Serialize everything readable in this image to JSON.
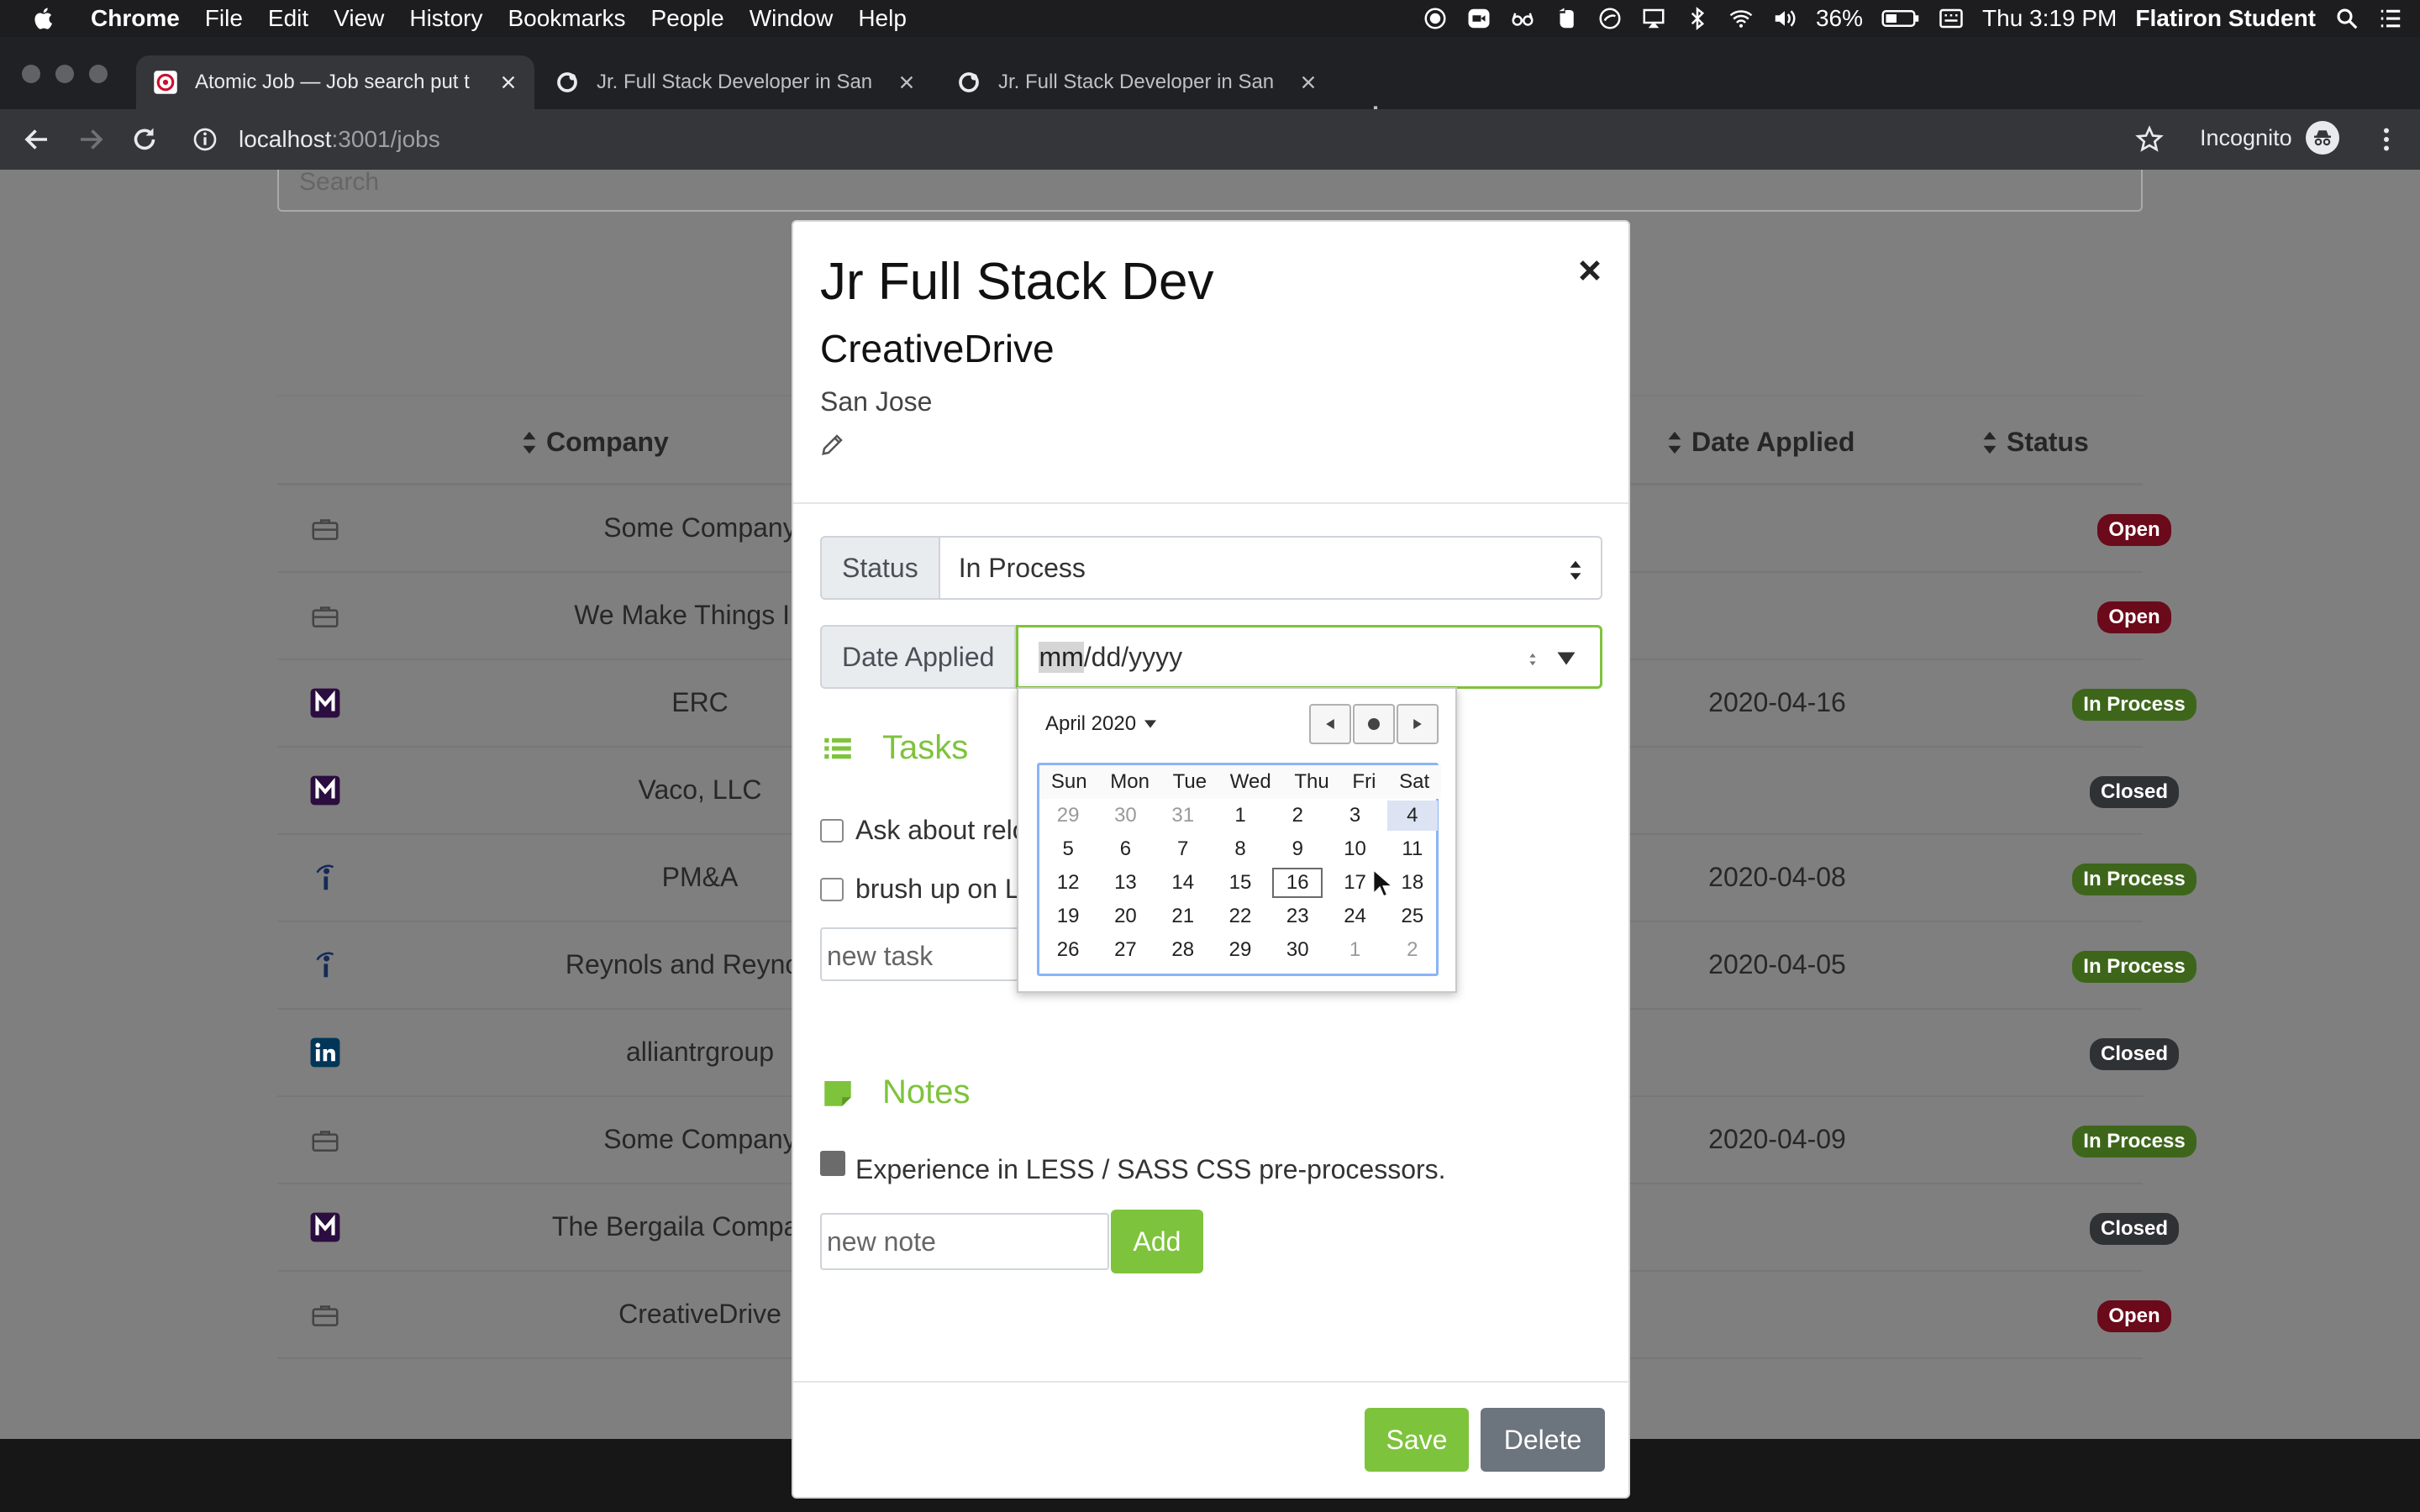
{
  "menubar": {
    "app": "Chrome",
    "items": [
      "File",
      "Edit",
      "View",
      "History",
      "Bookmarks",
      "People",
      "Window",
      "Help"
    ],
    "battery": "36%",
    "clock": "Thu 3:19 PM",
    "user": "Flatiron Student"
  },
  "tabs": [
    {
      "title": "Atomic Job — Job search put t",
      "active": true
    },
    {
      "title": "Jr. Full Stack Developer in San"
    },
    {
      "title": "Jr. Full Stack Developer in San"
    }
  ],
  "address": {
    "host": "localhost",
    "path": ":3001/jobs"
  },
  "incognito": "Incognito",
  "search": {
    "placeholder": "Search"
  },
  "table": {
    "headers": {
      "company": "Company",
      "date": "Date Applied",
      "status": "Status"
    },
    "rows": [
      {
        "company": "Some Company",
        "date": "",
        "status": "Open",
        "icon": "briefcase"
      },
      {
        "company": "We Make Things Inc.",
        "date": "",
        "status": "Open",
        "icon": "briefcase"
      },
      {
        "company": "ERC",
        "date": "2020-04-16",
        "status": "In Process",
        "icon": "monster"
      },
      {
        "company": "Vaco, LLC",
        "date": "",
        "status": "Closed",
        "icon": "monster"
      },
      {
        "company": "PM&A",
        "date": "2020-04-08",
        "status": "In Process",
        "icon": "indeed"
      },
      {
        "company": "Reynols and Reynolds",
        "date": "2020-04-05",
        "status": "In Process",
        "icon": "indeed"
      },
      {
        "company": "alliantrgroup",
        "date": "",
        "status": "Closed",
        "icon": "linkedin"
      },
      {
        "company": "Some Company",
        "date": "2020-04-09",
        "status": "In Process",
        "icon": "briefcase"
      },
      {
        "company": "The Bergaila Companies",
        "date": "",
        "status": "Closed",
        "icon": "monster"
      },
      {
        "company": "CreativeDrive",
        "date": "",
        "status": "Open",
        "icon": "briefcase"
      }
    ]
  },
  "modal": {
    "title": "Jr Full Stack Dev",
    "company": "CreativeDrive",
    "location": "San Jose",
    "status_label": "Status",
    "status_value": "In Process",
    "date_label": "Date Applied",
    "date_mm": "mm",
    "date_rest": "/dd/yyyy",
    "tasks_title": "Tasks",
    "tasks": [
      "Ask about relo",
      "brush up on L"
    ],
    "new_task_placeholder": "new task",
    "notes_title": "Notes",
    "notes": [
      "Experience in LESS / SASS CSS pre-processors."
    ],
    "new_note_placeholder": "new note",
    "add": "Add",
    "save": "Save",
    "delete": "Delete"
  },
  "calendar": {
    "month": "April 2020",
    "dow": [
      "Sun",
      "Mon",
      "Tue",
      "Wed",
      "Thu",
      "Fri",
      "Sat"
    ],
    "weeks": [
      [
        "29",
        "30",
        "31",
        "1",
        "2",
        "3",
        "4"
      ],
      [
        "5",
        "6",
        "7",
        "8",
        "9",
        "10",
        "11"
      ],
      [
        "12",
        "13",
        "14",
        "15",
        "16",
        "17",
        "18"
      ],
      [
        "19",
        "20",
        "21",
        "22",
        "23",
        "24",
        "25"
      ],
      [
        "26",
        "27",
        "28",
        "29",
        "30",
        "1",
        "2"
      ]
    ],
    "selected": "4",
    "today": "16"
  },
  "colors": {
    "accent": "#7ec33c",
    "open": "#c8102e",
    "in_process": "#7ec33c",
    "closed": "#5a6268"
  }
}
